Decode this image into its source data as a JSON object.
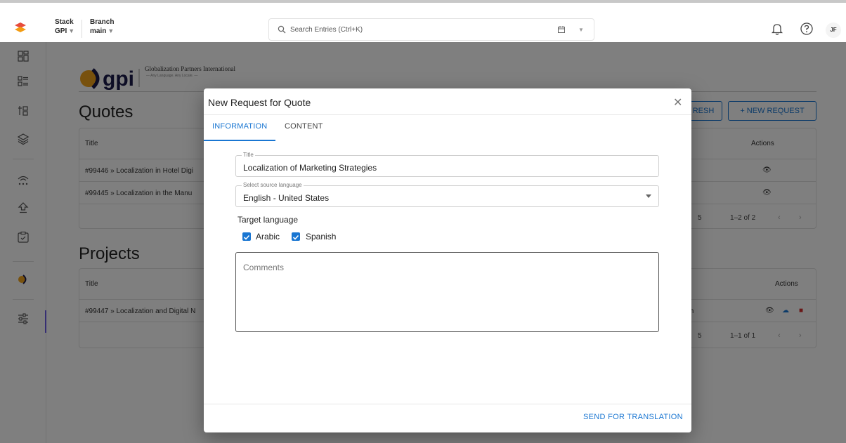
{
  "topbar": {
    "stack_label": "Stack",
    "stack_value": "GPI",
    "branch_label": "Branch",
    "branch_value": "main",
    "search_placeholder": "Search Entries (Ctrl+K)",
    "avatar_initials": "JF"
  },
  "background": {
    "company_name": "Globalization Partners International",
    "company_tagline": "— Any Language. Any Locale. —",
    "quotes": {
      "title": "Quotes",
      "refresh_label": "RESH",
      "new_request_label": "+ NEW REQUEST",
      "col_title": "Title",
      "col_actions": "Actions",
      "rows": [
        {
          "title": "#99446 » Localization in Hotel Digi"
        },
        {
          "title": "#99445 » Localization in the Manu"
        }
      ],
      "rows_per_page": "5",
      "range": "1–2 of 2"
    },
    "projects": {
      "title": "Projects",
      "col_title": "Title",
      "col_actions": "Actions",
      "rows": [
        {
          "title": "#99447 » Localization and Digital N",
          "lang": "nish"
        }
      ],
      "rows_per_page": "5",
      "range": "1–1 of 1"
    }
  },
  "dialog": {
    "title": "New Request for Quote",
    "tabs": [
      {
        "label": "INFORMATION",
        "active": true
      },
      {
        "label": "CONTENT",
        "active": false
      }
    ],
    "title_field": {
      "label": "Title",
      "value": "Localization of Marketing Strategies"
    },
    "source_language": {
      "label": "Select source language",
      "value": "English - United States"
    },
    "target_language_label": "Target language",
    "targets": [
      {
        "label": "Arabic",
        "checked": true
      },
      {
        "label": "Spanish",
        "checked": true
      }
    ],
    "comments_placeholder": "Comments",
    "send_label": "SEND FOR TRANSLATION"
  },
  "colors": {
    "accent": "#1976d2",
    "overlay": "#000000",
    "brand_orange": "#f39c12"
  }
}
